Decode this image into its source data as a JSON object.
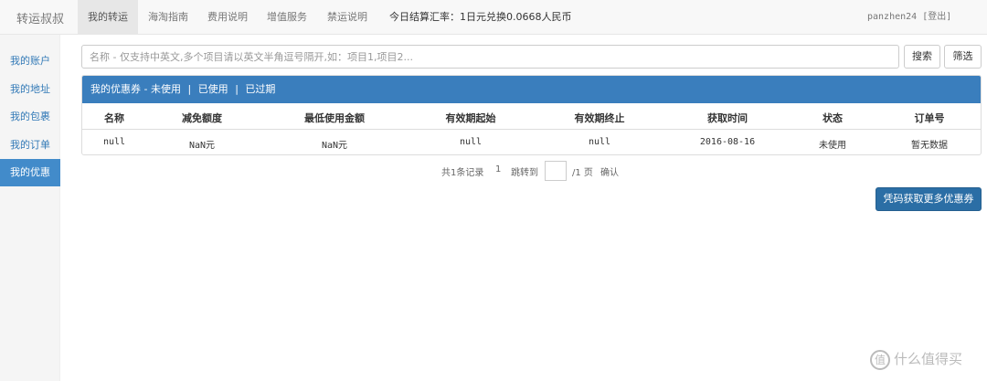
{
  "brand": "转运叔叔",
  "nav": {
    "items": [
      "我的转运",
      "海淘指南",
      "费用说明",
      "增值服务",
      "禁运说明"
    ],
    "rate": "今日结算汇率：1日元兑换0.0668人民币"
  },
  "user": {
    "name": "panzhen24",
    "logout": "[登出]"
  },
  "sidebar": {
    "items": [
      "我的账户",
      "我的地址",
      "我的包裹",
      "我的订单",
      "我的优惠"
    ]
  },
  "search": {
    "placeholder": "名称 - 仅支持中英文,多个项目请以英文半角逗号隔开,如：项目1,项目2...",
    "search_label": "搜索",
    "filter_label": "筛选"
  },
  "coupons": {
    "title": "我的优惠券 - ",
    "tabs": [
      "未使用",
      "已使用",
      "已过期"
    ],
    "separator": "|",
    "columns": [
      "名称",
      "减免额度",
      "最低使用金额",
      "有效期起始",
      "有效期终止",
      "获取时间",
      "状态",
      "订单号"
    ],
    "rows": [
      [
        "null",
        "NaN元",
        "NaN元",
        "null",
        "null",
        "2016-08-16",
        "未使用",
        "暂无数据"
      ]
    ]
  },
  "pager": {
    "total": "共1条记录",
    "current": "1",
    "goto": "跳转到",
    "pages": "/1 页",
    "confirm": "确认"
  },
  "more_button": "凭码获取更多优惠券",
  "watermark": {
    "logo": "值",
    "text": "什么值得买"
  }
}
